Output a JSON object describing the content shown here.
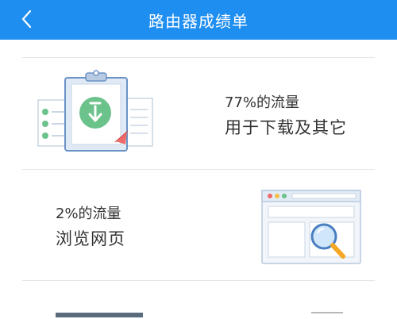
{
  "header": {
    "title": "路由器成绩单",
    "back_icon": "chevron-left-icon",
    "color": "#1e8ef0"
  },
  "cards": [
    {
      "percent_text": "77%的流量",
      "description": "用于下载及其它",
      "illustration_icon": "clipboard-download-icon"
    },
    {
      "percent_text": "2%的流量",
      "description": "浏览网页",
      "illustration_icon": "browser-search-icon"
    }
  ]
}
